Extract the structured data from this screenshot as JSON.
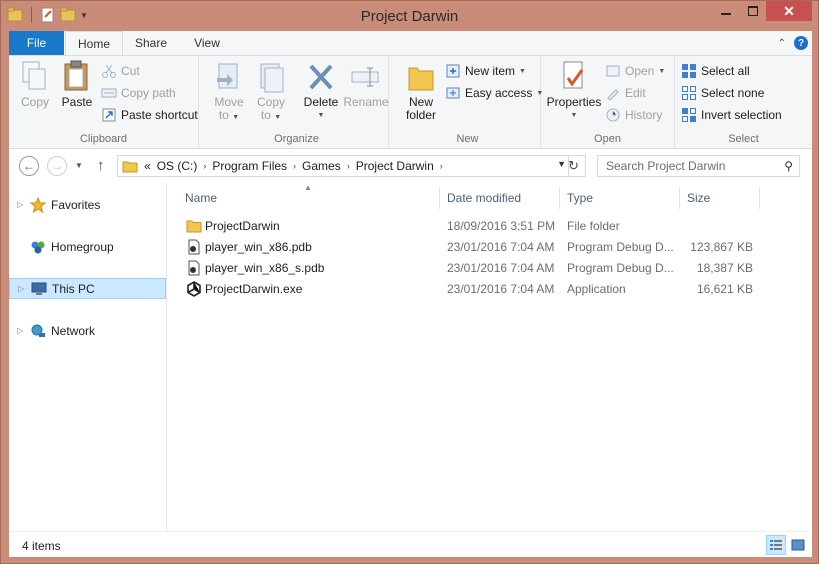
{
  "window": {
    "title": "Project Darwin"
  },
  "ribbon_tabs": {
    "file": "File",
    "home": "Home",
    "share": "Share",
    "view": "View"
  },
  "clipboard": {
    "label": "Clipboard",
    "copy": "Copy",
    "paste": "Paste",
    "cut": "Cut",
    "copy_path": "Copy path",
    "paste_shortcut": "Paste shortcut"
  },
  "organize": {
    "label": "Organize",
    "move_to_1": "Move",
    "move_to_2": "to",
    "copy_to_1": "Copy",
    "copy_to_2": "to",
    "delete": "Delete",
    "rename": "Rename"
  },
  "new": {
    "label": "New",
    "new_folder_1": "New",
    "new_folder_2": "folder",
    "new_item": "New item",
    "easy_access": "Easy access"
  },
  "open": {
    "label": "Open",
    "properties": "Properties",
    "open": "Open",
    "edit": "Edit",
    "history": "History"
  },
  "select": {
    "label": "Select",
    "select_all": "Select all",
    "select_none": "Select none",
    "invert_selection": "Invert selection"
  },
  "address": {
    "prefix": "«",
    "crumbs": [
      "OS (C:)",
      "Program Files",
      "Games",
      "Project Darwin"
    ]
  },
  "search": {
    "placeholder": "Search Project Darwin"
  },
  "navpane": {
    "items": [
      "Favorites",
      "Homegroup",
      "This PC",
      "Network"
    ]
  },
  "columns": {
    "name": "Name",
    "date": "Date modified",
    "type": "Type",
    "size": "Size"
  },
  "files": [
    {
      "name": "ProjectDarwin",
      "date": "18/09/2016 3:51 PM",
      "type": "File folder",
      "size": "",
      "icon": "folder-icon"
    },
    {
      "name": "player_win_x86.pdb",
      "date": "23/01/2016 7:04 AM",
      "type": "Program Debug D...",
      "size": "123,867 KB",
      "icon": "pdb-file-icon"
    },
    {
      "name": "player_win_x86_s.pdb",
      "date": "23/01/2016 7:04 AM",
      "type": "Program Debug D...",
      "size": "18,387 KB",
      "icon": "pdb-file-icon"
    },
    {
      "name": "ProjectDarwin.exe",
      "date": "23/01/2016 7:04 AM",
      "type": "Application",
      "size": "16,621 KB",
      "icon": "unity-exe-icon"
    }
  ],
  "status": {
    "count": "4 items"
  },
  "colors": {
    "accent": "#1979ca",
    "frame": "#c98c78",
    "selection": "#cce8ff"
  }
}
